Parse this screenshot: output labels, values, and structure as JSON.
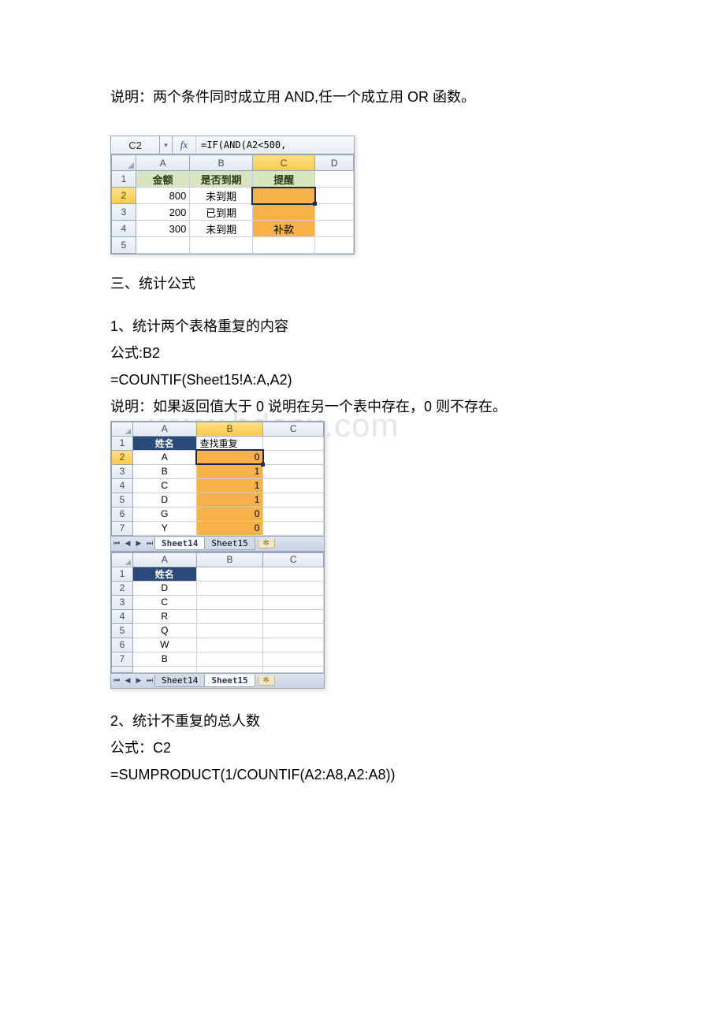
{
  "paragraphs": {
    "p1": "说明：两个条件同时成立用 AND,任一个成立用 OR 函数。",
    "h3": "三、统计公式",
    "s1_title": "1、统计两个表格重复的内容",
    "s1_formula_label": "公式:B2",
    "s1_formula": "=COUNTIF(Sheet15!A:A,A2)",
    "s1_explain": "说明：如果返回值大于 0 说明在另一个表中存在，0 则不存在。",
    "s2_title": "2、统计不重复的总人数",
    "s2_formula_label": "公式：C2",
    "s2_formula": "=SUMPRODUCT(1/COUNTIF(A2:A8,A2:A8))"
  },
  "excel1": {
    "namebox": "C2",
    "fx_label": "fx",
    "formula_text": "=IF(AND(A2<500,",
    "cols": [
      "A",
      "B",
      "C",
      "D"
    ],
    "headers": {
      "A": "金额",
      "B": "是否到期",
      "C": "提醒"
    },
    "rows": [
      {
        "n": "1"
      },
      {
        "n": "2",
        "A": "800",
        "B": "未到期",
        "C": ""
      },
      {
        "n": "3",
        "A": "200",
        "B": "已到期",
        "C": ""
      },
      {
        "n": "4",
        "A": "300",
        "B": "未到期",
        "C": "补款"
      },
      {
        "n": "5"
      }
    ]
  },
  "excel2_top": {
    "cols": [
      "A",
      "B",
      "C"
    ],
    "header_A": "姓名",
    "header_B": "查找重复",
    "rows": [
      {
        "n": "1"
      },
      {
        "n": "2",
        "A": "A",
        "B": "0"
      },
      {
        "n": "3",
        "A": "B",
        "B": "1"
      },
      {
        "n": "4",
        "A": "C",
        "B": "1"
      },
      {
        "n": "5",
        "A": "D",
        "B": "1"
      },
      {
        "n": "6",
        "A": "G",
        "B": "0"
      },
      {
        "n": "7",
        "A": "Y",
        "B": "0"
      }
    ],
    "tabs": {
      "t1": "Sheet14",
      "t2": "Sheet15"
    }
  },
  "excel2_bottom": {
    "cols": [
      "A",
      "B",
      "C"
    ],
    "header_A": "姓名",
    "rows": [
      {
        "n": "1"
      },
      {
        "n": "2",
        "A": "D"
      },
      {
        "n": "3",
        "A": "C"
      },
      {
        "n": "4",
        "A": "R"
      },
      {
        "n": "5",
        "A": "Q"
      },
      {
        "n": "6",
        "A": "W"
      },
      {
        "n": "7",
        "A": "B"
      }
    ],
    "tabs": {
      "t1": "Sheet14",
      "t2": "Sheet15"
    }
  },
  "watermark": "www.bdocx.com"
}
